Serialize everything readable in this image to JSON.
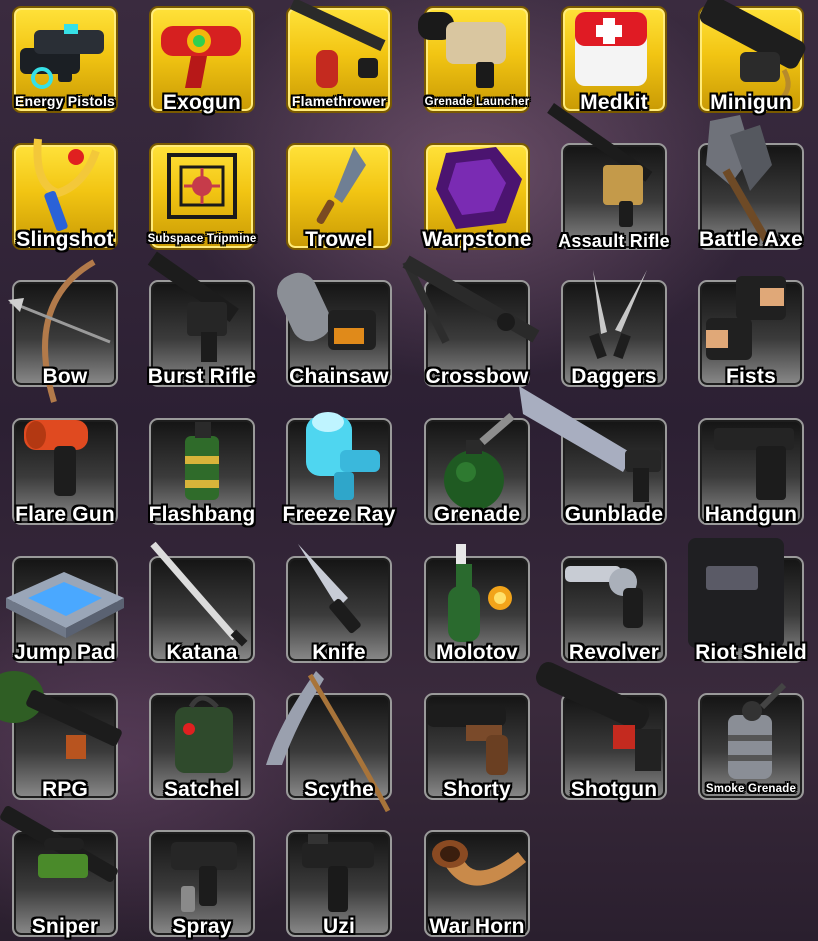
{
  "inventory": {
    "items": [
      {
        "label": "Energy Pistols",
        "tier": "rare",
        "icon": "energy-pistols-icon"
      },
      {
        "label": "Exogun",
        "tier": "rare",
        "icon": "exogun-icon"
      },
      {
        "label": "Flamethrower",
        "tier": "rare",
        "icon": "flamethrower-icon"
      },
      {
        "label": "Grenade Launcher",
        "tier": "rare",
        "icon": "grenade-launcher-icon"
      },
      {
        "label": "Medkit",
        "tier": "rare",
        "icon": "medkit-icon"
      },
      {
        "label": "Minigun",
        "tier": "rare",
        "icon": "minigun-icon"
      },
      {
        "label": "Slingshot",
        "tier": "rare",
        "icon": "slingshot-icon"
      },
      {
        "label": "Subspace Tripmine",
        "tier": "rare",
        "icon": "subspace-tripmine-icon"
      },
      {
        "label": "Trowel",
        "tier": "rare",
        "icon": "trowel-icon"
      },
      {
        "label": "Warpstone",
        "tier": "rare",
        "icon": "warpstone-icon"
      },
      {
        "label": "Assault Rifle",
        "tier": "common",
        "icon": "assault-rifle-icon"
      },
      {
        "label": "Battle Axe",
        "tier": "common",
        "icon": "battle-axe-icon"
      },
      {
        "label": "Bow",
        "tier": "common",
        "icon": "bow-icon"
      },
      {
        "label": "Burst Rifle",
        "tier": "common",
        "icon": "burst-rifle-icon"
      },
      {
        "label": "Chainsaw",
        "tier": "common",
        "icon": "chainsaw-icon"
      },
      {
        "label": "Crossbow",
        "tier": "common",
        "icon": "crossbow-icon"
      },
      {
        "label": "Daggers",
        "tier": "common",
        "icon": "daggers-icon"
      },
      {
        "label": "Fists",
        "tier": "common",
        "icon": "fists-icon"
      },
      {
        "label": "Flare Gun",
        "tier": "common",
        "icon": "flare-gun-icon"
      },
      {
        "label": "Flashbang",
        "tier": "common",
        "icon": "flashbang-icon"
      },
      {
        "label": "Freeze Ray",
        "tier": "common",
        "icon": "freeze-ray-icon"
      },
      {
        "label": "Grenade",
        "tier": "common",
        "icon": "grenade-icon"
      },
      {
        "label": "Gunblade",
        "tier": "common",
        "icon": "gunblade-icon"
      },
      {
        "label": "Handgun",
        "tier": "common",
        "icon": "handgun-icon"
      },
      {
        "label": "Jump Pad",
        "tier": "common",
        "icon": "jump-pad-icon"
      },
      {
        "label": "Katana",
        "tier": "common",
        "icon": "katana-icon"
      },
      {
        "label": "Knife",
        "tier": "common",
        "icon": "knife-icon"
      },
      {
        "label": "Molotov",
        "tier": "common",
        "icon": "molotov-icon"
      },
      {
        "label": "Revolver",
        "tier": "common",
        "icon": "revolver-icon"
      },
      {
        "label": "Riot Shield",
        "tier": "common",
        "icon": "riot-shield-icon"
      },
      {
        "label": "RPG",
        "tier": "common",
        "icon": "rpg-icon"
      },
      {
        "label": "Satchel",
        "tier": "common",
        "icon": "satchel-icon"
      },
      {
        "label": "Scythe",
        "tier": "common",
        "icon": "scythe-icon"
      },
      {
        "label": "Shorty",
        "tier": "common",
        "icon": "shorty-icon"
      },
      {
        "label": "Shotgun",
        "tier": "common",
        "icon": "shotgun-icon"
      },
      {
        "label": "Smoke Grenade",
        "tier": "common",
        "icon": "smoke-grenade-icon"
      },
      {
        "label": "Sniper",
        "tier": "common",
        "icon": "sniper-icon"
      },
      {
        "label": "Spray",
        "tier": "common",
        "icon": "spray-icon"
      },
      {
        "label": "Uzi",
        "tier": "common",
        "icon": "uzi-icon"
      },
      {
        "label": "War Horn",
        "tier": "common",
        "icon": "war-horn-icon"
      }
    ]
  },
  "colors": {
    "rare_slot": "#f2c513",
    "common_slot": "#3b3b3b",
    "label_text": "#ffffff",
    "background": "#2c2033"
  }
}
